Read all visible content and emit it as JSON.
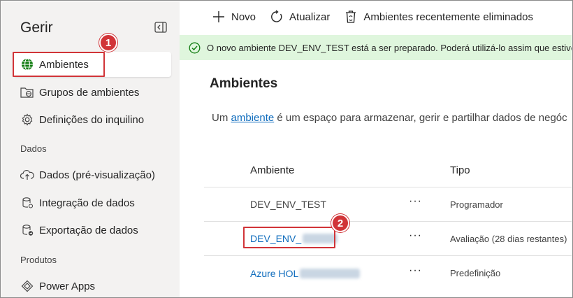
{
  "sidebar": {
    "title": "Gerir",
    "items": [
      {
        "label": "Ambientes"
      },
      {
        "label": "Grupos de ambientes"
      },
      {
        "label": "Definições do inquilino"
      }
    ],
    "sections": [
      {
        "label": "Dados"
      },
      {
        "label": "Produtos"
      }
    ],
    "data_items": [
      {
        "label": "Dados (pré-visualização)"
      },
      {
        "label": "Integração de dados"
      },
      {
        "label": "Exportação de dados"
      }
    ],
    "product_items": [
      {
        "label": "Power Apps"
      }
    ]
  },
  "toolbar": {
    "new_label": "Novo",
    "refresh_label": "Atualizar",
    "deleted_label": "Ambientes recentemente eliminados"
  },
  "banner": {
    "text": "O novo ambiente DEV_ENV_TEST está a ser preparado. Poderá utilizá-lo assim que estiver"
  },
  "main": {
    "title": "Ambientes",
    "description_before": "Um ",
    "description_link": "ambiente",
    "description_after": " é um espaço para armazenar, gerir e partilhar dados de negóc"
  },
  "table": {
    "headers": {
      "environment": "Ambiente",
      "type": "Tipo"
    },
    "rows": [
      {
        "name": "DEV_ENV_TEST",
        "more": "···",
        "type": "Programador"
      },
      {
        "name": "DEV_ENV_",
        "more": "···",
        "type": "Avaliação (28 dias restantes)"
      },
      {
        "name": "Azure HOL",
        "more": "···",
        "type": "Predefinição"
      }
    ]
  },
  "annotations": {
    "step1": "1",
    "step2": "2"
  },
  "colors": {
    "highlight": "#d13438",
    "link": "#0f6cbd",
    "banner_bg": "#dff6dd",
    "success": "#107c10"
  }
}
